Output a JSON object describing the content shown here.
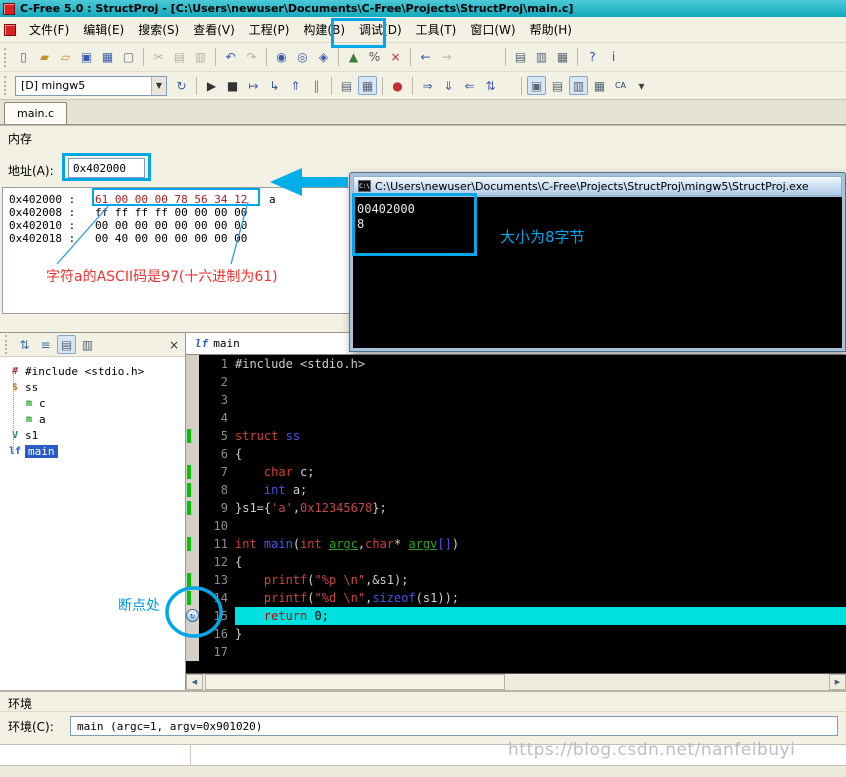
{
  "title_bar": {
    "title": "C-Free 5.0 : StructProj - [C:\\Users\\newuser\\Documents\\C-Free\\Projects\\StructProj\\main.c]"
  },
  "menu": {
    "items": [
      {
        "id": "file",
        "label": "文件(F)"
      },
      {
        "id": "edit",
        "label": "编辑(E)"
      },
      {
        "id": "search",
        "label": "搜索(S)"
      },
      {
        "id": "view",
        "label": "查看(V)"
      },
      {
        "id": "project",
        "label": "工程(P)"
      },
      {
        "id": "build",
        "label": "构建(B)"
      },
      {
        "id": "debug",
        "label": "调试(D)"
      },
      {
        "id": "tools",
        "label": "工具(T)"
      },
      {
        "id": "window",
        "label": "窗口(W)"
      },
      {
        "id": "help",
        "label": "帮助(H)"
      }
    ]
  },
  "toolbar1": {
    "icons": [
      {
        "n": "new-file-icon",
        "g": "▯",
        "c": "#556677"
      },
      {
        "n": "open-file-icon",
        "g": "▰",
        "c": "#c89028"
      },
      {
        "n": "reopen-file-icon",
        "g": "▱",
        "c": "#c89028"
      },
      {
        "n": "save-icon",
        "g": "▣",
        "c": "#3a5ba8"
      },
      {
        "n": "save-all-icon",
        "g": "▦",
        "c": "#3a5ba8"
      },
      {
        "n": "close-file-icon",
        "g": "▢",
        "c": "#556677"
      },
      {
        "sep": true
      },
      {
        "n": "cut-icon",
        "g": "✂",
        "dis": true
      },
      {
        "n": "copy-icon",
        "g": "▤",
        "dis": true
      },
      {
        "n": "paste-icon",
        "g": "▥",
        "dis": true
      },
      {
        "sep": true
      },
      {
        "n": "undo-icon",
        "g": "↶",
        "c": "#3a5ba8"
      },
      {
        "n": "redo-icon",
        "g": "↷",
        "dis": true
      },
      {
        "sep": true
      },
      {
        "n": "find-icon",
        "g": "◉",
        "c": "#3a5ba8"
      },
      {
        "n": "find-in-files-icon",
        "g": "◎",
        "c": "#3a5ba8"
      },
      {
        "n": "replace-icon",
        "g": "◈",
        "c": "#3a5ba8"
      },
      {
        "sep": true
      },
      {
        "n": "build-icon",
        "g": "▲",
        "c": "#38813a"
      },
      {
        "n": "progress-icon",
        "g": "%",
        "c": "#555555"
      },
      {
        "n": "stop-build-icon",
        "g": "×",
        "c": "#c03030"
      },
      {
        "sep": true
      },
      {
        "n": "back-icon",
        "g": "←",
        "c": "#3a5ba8"
      },
      {
        "n": "forward-icon",
        "g": "→",
        "dis": true
      },
      {
        "sep": true,
        "ml": 48
      },
      {
        "n": "prev-window-icon",
        "g": "▤",
        "c": "#556677"
      },
      {
        "n": "next-window-icon",
        "g": "▥",
        "c": "#556677"
      },
      {
        "n": "window-list-icon",
        "g": "▦",
        "c": "#556677"
      },
      {
        "sep": true
      },
      {
        "n": "help-icon",
        "g": "?",
        "c": "#2a52be"
      },
      {
        "n": "about-icon",
        "g": "i",
        "c": "#2a52be"
      }
    ]
  },
  "toolbar2": {
    "combo_value": "[D] mingw5",
    "combo_arrow": "▼",
    "icons": [
      {
        "n": "refresh-target-icon",
        "g": "↻",
        "c": "#3a5ba8"
      },
      {
        "sep": true
      },
      {
        "n": "run-icon",
        "g": "▶",
        "c": "#333333"
      },
      {
        "n": "stop-debug-icon",
        "g": "■",
        "c": "#333333"
      },
      {
        "n": "step-over-icon",
        "g": "↦",
        "c": "#3a5ba8"
      },
      {
        "n": "step-into-icon",
        "g": "↳",
        "c": "#3a5ba8"
      },
      {
        "n": "step-out-icon",
        "g": "⇑",
        "c": "#3a5ba8"
      },
      {
        "n": "pause-icon",
        "g": "‖",
        "c": "#d07820"
      },
      {
        "sep": true
      },
      {
        "n": "watch-window-icon",
        "g": "▤",
        "c": "#556677"
      },
      {
        "n": "memory-window-icon",
        "g": "▦",
        "c": "#556677",
        "pressed": true
      },
      {
        "sep": true
      },
      {
        "n": "toggle-breakpoint-icon",
        "g": "●",
        "c": "#c03030"
      },
      {
        "sep": true
      },
      {
        "n": "run-to-cursor-icon",
        "g": "⇒",
        "c": "#3a5ba8"
      },
      {
        "n": "jump-down-icon",
        "g": "⇓",
        "c": "#3a5ba8"
      },
      {
        "n": "jump-back-icon",
        "g": "⇐",
        "c": "#3a5ba8"
      },
      {
        "n": "swap-view-icon",
        "g": "⇅",
        "c": "#3a5ba8"
      },
      {
        "sep": true,
        "ml": 20
      },
      {
        "n": "debug-window-1-icon",
        "g": "▣",
        "c": "#556677",
        "pressed": true
      },
      {
        "n": "debug-window-2-icon",
        "g": "▤",
        "c": "#556677"
      },
      {
        "n": "debug-window-3-icon",
        "g": "▥",
        "c": "#556677",
        "pressed": true
      },
      {
        "n": "debug-window-4-icon",
        "g": "▦",
        "c": "#556677"
      },
      {
        "n": "console-window-icon",
        "g": "CA",
        "c": "#224466"
      },
      {
        "n": "toolbar-more-icon",
        "g": "▾",
        "c": "#444444"
      }
    ]
  },
  "tabs": {
    "active": "main.c"
  },
  "memory_panel": {
    "header": "内存",
    "address_label": "地址(A):",
    "address_value": "0x402000",
    "rows": [
      {
        "addr": "0x402000 :",
        "hex": "61 00 00 00 78 56 34 12",
        "ascii": "a",
        "changed": true
      },
      {
        "addr": "0x402008 :",
        "hex": "ff ff ff ff 00 00 00 00",
        "ascii": ""
      },
      {
        "addr": "0x402010 :",
        "hex": "00 00 00 00 00 00 00 00",
        "ascii": ""
      },
      {
        "addr": "0x402018 :",
        "hex": "00 40 00 00 00 00 00 00",
        "ascii": ""
      }
    ]
  },
  "scrollbar": {
    "left": "◀",
    "right": "▶",
    "grip": "⋮⋮⋮"
  },
  "console": {
    "title": "C:\\Users\\newuser\\Documents\\C-Free\\Projects\\StructProj\\mingw5\\StructProj.exe",
    "icon_label": "C:\\",
    "lines": [
      "00402000",
      "8"
    ]
  },
  "left_panel": {
    "icons": [
      {
        "n": "sort-az-icon",
        "g": "⇅",
        "c": "#3a6ea5"
      },
      {
        "n": "sort-type-icon",
        "g": "≡",
        "c": "#3a6ea5"
      },
      {
        "n": "view-tree-icon",
        "g": "▤",
        "c": "#556677",
        "pressed": true
      },
      {
        "n": "view-flat-icon",
        "g": "▥",
        "c": "#556677"
      }
    ],
    "close_glyph": "×"
  },
  "symbols": {
    "items": [
      {
        "icon": "#",
        "icon_name": "include-icon",
        "icon_color": "#a03030",
        "label": "#include <stdio.h>",
        "depth": 0
      },
      {
        "icon": "$",
        "icon_name": "struct-icon",
        "icon_color": "#b08020",
        "label": "ss",
        "depth": 0
      },
      {
        "icon": "m",
        "icon_name": "member-icon",
        "icon_color": "#20a020",
        "label": "c",
        "depth": 1
      },
      {
        "icon": "m",
        "icon_name": "member-icon",
        "icon_color": "#20a020",
        "label": "a",
        "depth": 1
      },
      {
        "icon": "V",
        "icon_name": "variable-icon",
        "icon_color": "#208080",
        "label": "s1",
        "depth": 0
      },
      {
        "icon": "lf",
        "icon_name": "function-icon",
        "icon_color": "#3060c0",
        "label": "main",
        "depth": 0,
        "selected": true
      }
    ]
  },
  "editor": {
    "function_icon": "lf",
    "function_combo": "main",
    "lines": [
      {
        "n": "1",
        "segs": [
          [
            "pln",
            "#include <stdio.h>"
          ]
        ]
      },
      {
        "n": "2",
        "segs": []
      },
      {
        "n": "3",
        "segs": []
      },
      {
        "n": "4",
        "segs": []
      },
      {
        "n": "5",
        "segs": [
          [
            "kw",
            "struct"
          ],
          [
            "pln",
            " "
          ],
          [
            "typ",
            "ss"
          ]
        ],
        "mark": true
      },
      {
        "n": "6",
        "segs": [
          [
            "pln",
            "{"
          ]
        ]
      },
      {
        "n": "7",
        "segs": [
          [
            "pln",
            "    "
          ],
          [
            "kw",
            "char"
          ],
          [
            "pln",
            " c;"
          ]
        ],
        "mark": true
      },
      {
        "n": "8",
        "segs": [
          [
            "pln",
            "    "
          ],
          [
            "typ",
            "int"
          ],
          [
            "pln",
            " a;"
          ]
        ],
        "mark": true
      },
      {
        "n": "9",
        "segs": [
          [
            "pln",
            "}s1={"
          ],
          [
            "str",
            "'a'"
          ],
          [
            "pln",
            ","
          ],
          [
            "str",
            "0x12345678"
          ],
          [
            "pln",
            "};"
          ]
        ],
        "mark": true
      },
      {
        "n": "10",
        "segs": []
      },
      {
        "n": "11",
        "segs": [
          [
            "kw",
            "int"
          ],
          [
            "pln",
            " "
          ],
          [
            "typ",
            "main"
          ],
          [
            "pln",
            "("
          ],
          [
            "kw",
            "int"
          ],
          [
            "pln",
            " "
          ],
          [
            "arg",
            "argc"
          ],
          [
            "pln",
            ","
          ],
          [
            "kw",
            "char"
          ],
          [
            "pln",
            "* "
          ],
          [
            "arg",
            "argv"
          ],
          [
            "typ",
            "[]"
          ],
          [
            "pln",
            ")"
          ]
        ],
        "mark": true
      },
      {
        "n": "12",
        "segs": [
          [
            "pln",
            "{"
          ]
        ]
      },
      {
        "n": "13",
        "segs": [
          [
            "pln",
            "    "
          ],
          [
            "kw",
            "printf"
          ],
          [
            "pln",
            "("
          ],
          [
            "str",
            "\"%p \\n\""
          ],
          [
            "pln",
            ",&s1);"
          ]
        ],
        "mark": true
      },
      {
        "n": "14",
        "segs": [
          [
            "pln",
            "    "
          ],
          [
            "kw",
            "printf"
          ],
          [
            "pln",
            "("
          ],
          [
            "str",
            "\"%d \\n\""
          ],
          [
            "pln",
            ","
          ],
          [
            "typ",
            "sizeof"
          ],
          [
            "pln",
            "(s1));"
          ]
        ],
        "mark": true
      },
      {
        "n": "15",
        "segs": [
          [
            "pln",
            "    "
          ],
          [
            "kw",
            "return"
          ],
          [
            "pln",
            " 0;"
          ]
        ],
        "current": true,
        "bpicon": true
      },
      {
        "n": "16",
        "segs": [
          [
            "pln",
            "}"
          ]
        ]
      },
      {
        "n": "17",
        "segs": []
      }
    ]
  },
  "env_panel": {
    "header": "环境",
    "label": "环境(C):",
    "value": "main (argc=1, argv=0x901020)"
  },
  "annotations": {
    "ascii_note": "字符a的ASCII码是97(十六进制为61)",
    "size_note": "大小为8字节",
    "breakpoint_note": "断点处"
  },
  "watermark": "https://blog.csdn.net/nanfeibuyi"
}
